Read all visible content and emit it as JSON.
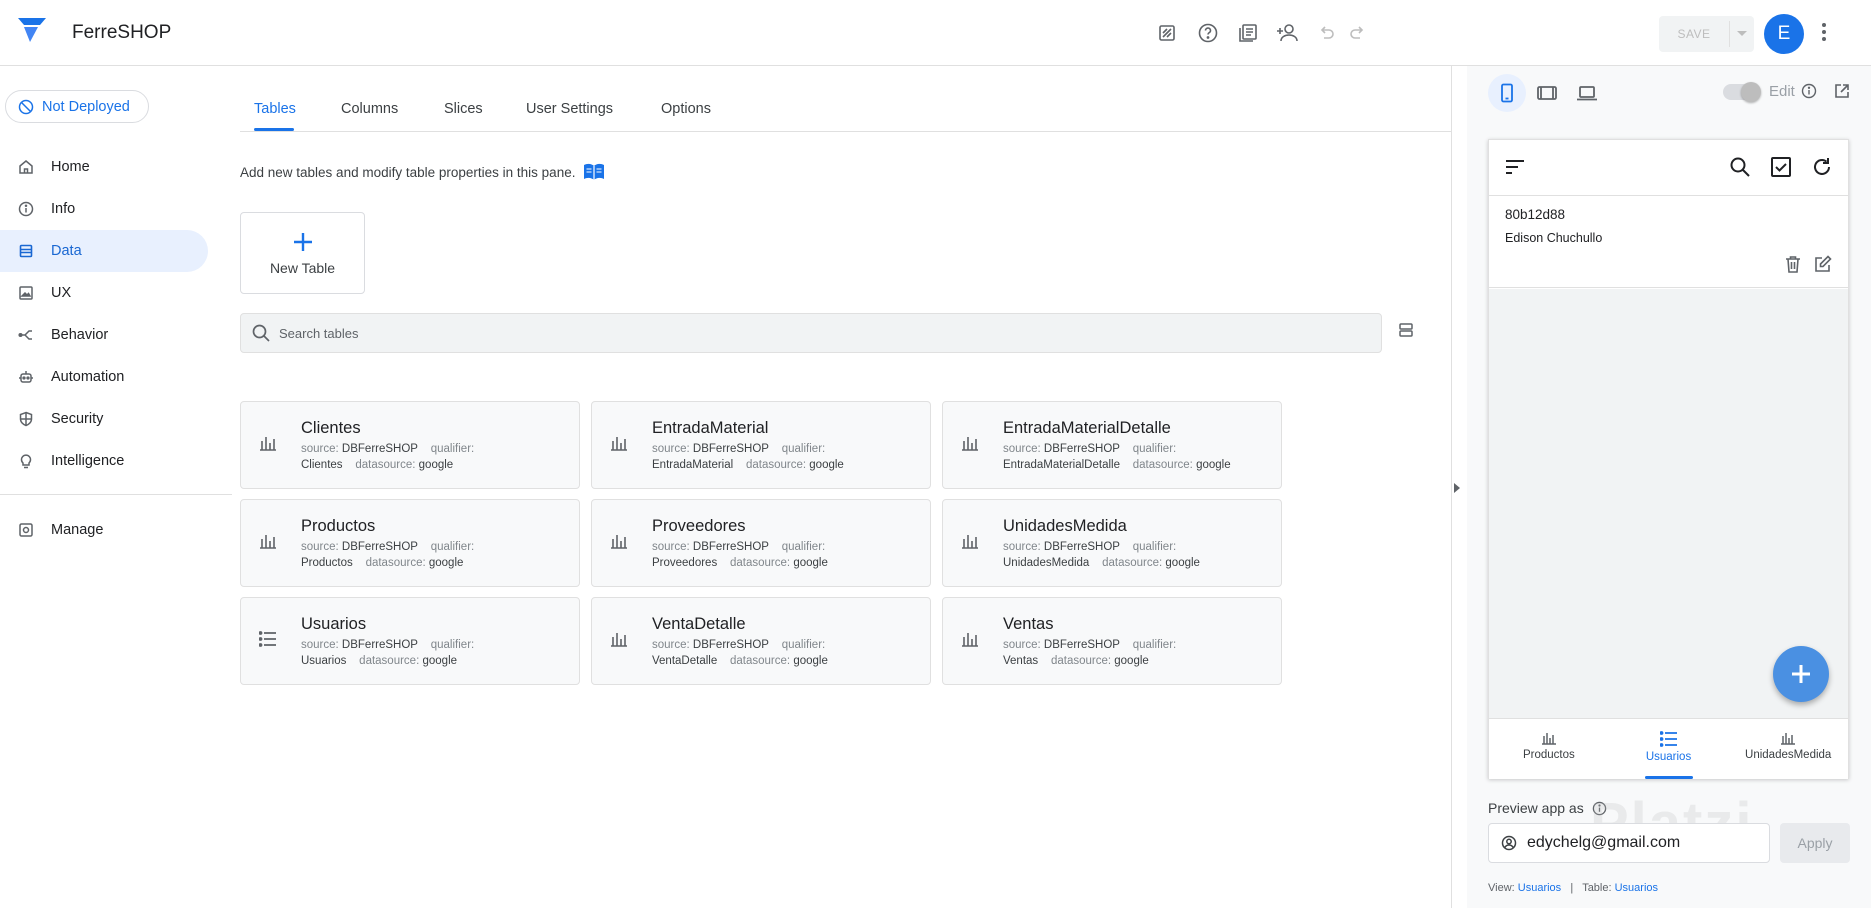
{
  "app": {
    "title": "FerreSHOP"
  },
  "toolbar": {
    "save_label": "SAVE",
    "avatar_letter": "E"
  },
  "deploy": {
    "label": "Not Deployed"
  },
  "nav": {
    "items": [
      {
        "label": "Home",
        "icon": "home-icon"
      },
      {
        "label": "Info",
        "icon": "info-icon"
      },
      {
        "label": "Data",
        "icon": "data-icon"
      },
      {
        "label": "UX",
        "icon": "image-icon"
      },
      {
        "label": "Behavior",
        "icon": "branch-icon"
      },
      {
        "label": "Automation",
        "icon": "robot-icon"
      },
      {
        "label": "Security",
        "icon": "shield-icon"
      },
      {
        "label": "Intelligence",
        "icon": "lightbulb-icon"
      }
    ],
    "manage": "Manage"
  },
  "tabs": [
    "Tables",
    "Columns",
    "Slices",
    "User Settings",
    "Options"
  ],
  "main": {
    "intro": "Add new tables and modify table properties in this pane.",
    "new_table": "New Table",
    "search_placeholder": "Search tables"
  },
  "labels": {
    "source": "source:",
    "qualifier": "qualifier:",
    "datasource": "datasource:"
  },
  "tables": [
    {
      "name": "Clientes",
      "source": "DBFerreSHOP",
      "qualifier": "Clientes",
      "datasource": "google",
      "icon": "chart-icon"
    },
    {
      "name": "EntradaMaterial",
      "source": "DBFerreSHOP",
      "qualifier": "EntradaMaterial",
      "datasource": "google",
      "icon": "chart-icon"
    },
    {
      "name": "EntradaMaterialDetalle",
      "source": "DBFerreSHOP",
      "qualifier": "EntradaMaterialDetalle",
      "datasource": "google",
      "icon": "chart-icon"
    },
    {
      "name": "Productos",
      "source": "DBFerreSHOP",
      "qualifier": "Productos",
      "datasource": "google",
      "icon": "chart-icon"
    },
    {
      "name": "Proveedores",
      "source": "DBFerreSHOP",
      "qualifier": "Proveedores",
      "datasource": "google",
      "icon": "chart-icon"
    },
    {
      "name": "UnidadesMedida",
      "source": "DBFerreSHOP",
      "qualifier": "UnidadesMedida",
      "datasource": "google",
      "icon": "chart-icon"
    },
    {
      "name": "Usuarios",
      "source": "DBFerreSHOP",
      "qualifier": "Usuarios",
      "datasource": "google",
      "icon": "list-icon"
    },
    {
      "name": "VentaDetalle",
      "source": "DBFerreSHOP",
      "qualifier": "VentaDetalle",
      "datasource": "google",
      "icon": "chart-icon"
    },
    {
      "name": "Ventas",
      "source": "DBFerreSHOP",
      "qualifier": "Ventas",
      "datasource": "google",
      "icon": "chart-icon"
    }
  ],
  "preview": {
    "edit_label": "Edit",
    "record": {
      "id": "80b12d88",
      "name": "Edison Chuchullo"
    },
    "bottom_nav": [
      {
        "label": "Productos",
        "icon": "chart-icon"
      },
      {
        "label": "Usuarios",
        "icon": "list-icon"
      },
      {
        "label": "UnidadesMedida",
        "icon": "chart-icon"
      }
    ],
    "preview_as_label": "Preview app as",
    "email": "edychelg@gmail.com",
    "apply_label": "Apply",
    "view_label": "View:",
    "view_value": "Usuarios",
    "table_label": "Table:",
    "table_value": "Usuarios",
    "separator": "|"
  },
  "watermark": "Platzi",
  "colors": {
    "accent": "#1a73e8",
    "fab": "#4a90e2",
    "active_nav_bg": "#e8f0fe"
  }
}
